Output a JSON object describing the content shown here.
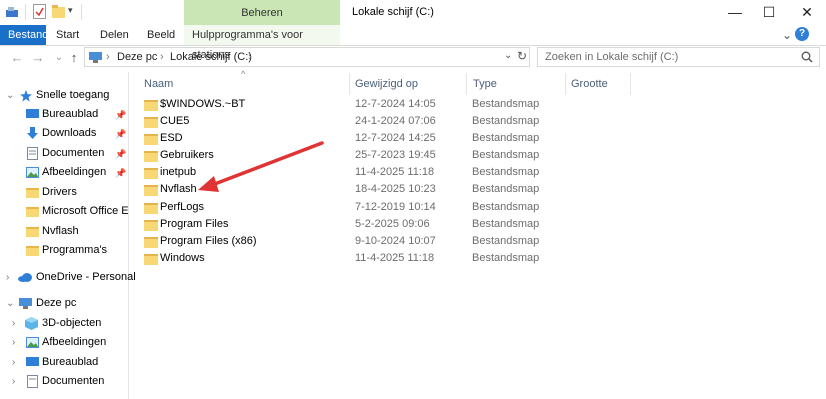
{
  "window": {
    "title": "Lokale schijf (C:)",
    "context_header": "Beheren",
    "minimize": "—",
    "maximize": "☐",
    "close": "✕"
  },
  "ribbon": {
    "tabs": [
      "Bestand",
      "Start",
      "Delen",
      "Beeld",
      "Hulpprogramma's voor stations"
    ],
    "expand": "⌄",
    "help": "?"
  },
  "address": {
    "back": "←",
    "forward": "→",
    "history": "⌄",
    "up": "↑",
    "crumbs": [
      "Deze pc",
      "Lokale schijf (C:)"
    ],
    "sep": "›",
    "refresh": "↻"
  },
  "search": {
    "placeholder": "Zoeken in Lokale schijf (C:)"
  },
  "nav": {
    "quick_access": "Snelle toegang",
    "quick_items": [
      "Bureaublad",
      "Downloads",
      "Documenten",
      "Afbeeldingen",
      "Drivers",
      "Microsoft Office En",
      "Nvflash",
      "Programma's"
    ],
    "onedrive": "OneDrive - Personal",
    "this_pc": "Deze pc",
    "pc_items": [
      "3D-objecten",
      "Afbeeldingen",
      "Bureaublad",
      "Documenten"
    ]
  },
  "columns": {
    "name": "Naam",
    "modified": "Gewijzigd op",
    "type": "Type",
    "size": "Grootte"
  },
  "files": [
    {
      "name": "$WINDOWS.~BT",
      "date": "12-7-2024 14:05",
      "type": "Bestandsmap"
    },
    {
      "name": "CUE5",
      "date": "24-1-2024 07:06",
      "type": "Bestandsmap"
    },
    {
      "name": "ESD",
      "date": "12-7-2024 14:25",
      "type": "Bestandsmap"
    },
    {
      "name": "Gebruikers",
      "date": "25-7-2023 19:45",
      "type": "Bestandsmap"
    },
    {
      "name": "inetpub",
      "date": "11-4-2025 11:18",
      "type": "Bestandsmap"
    },
    {
      "name": "Nvflash",
      "date": "18-4-2025 10:23",
      "type": "Bestandsmap"
    },
    {
      "name": "PerfLogs",
      "date": "7-12-2019 10:14",
      "type": "Bestandsmap"
    },
    {
      "name": "Program Files",
      "date": "5-2-2025 09:06",
      "type": "Bestandsmap"
    },
    {
      "name": "Program Files (x86)",
      "date": "9-10-2024 10:07",
      "type": "Bestandsmap"
    },
    {
      "name": "Windows",
      "date": "11-4-2025 11:18",
      "type": "Bestandsmap"
    }
  ],
  "colors": {
    "accent": "#1a6fc9",
    "context_tab": "#c9e6b4",
    "arrow": "#e03434",
    "folder": "#f8d775"
  }
}
